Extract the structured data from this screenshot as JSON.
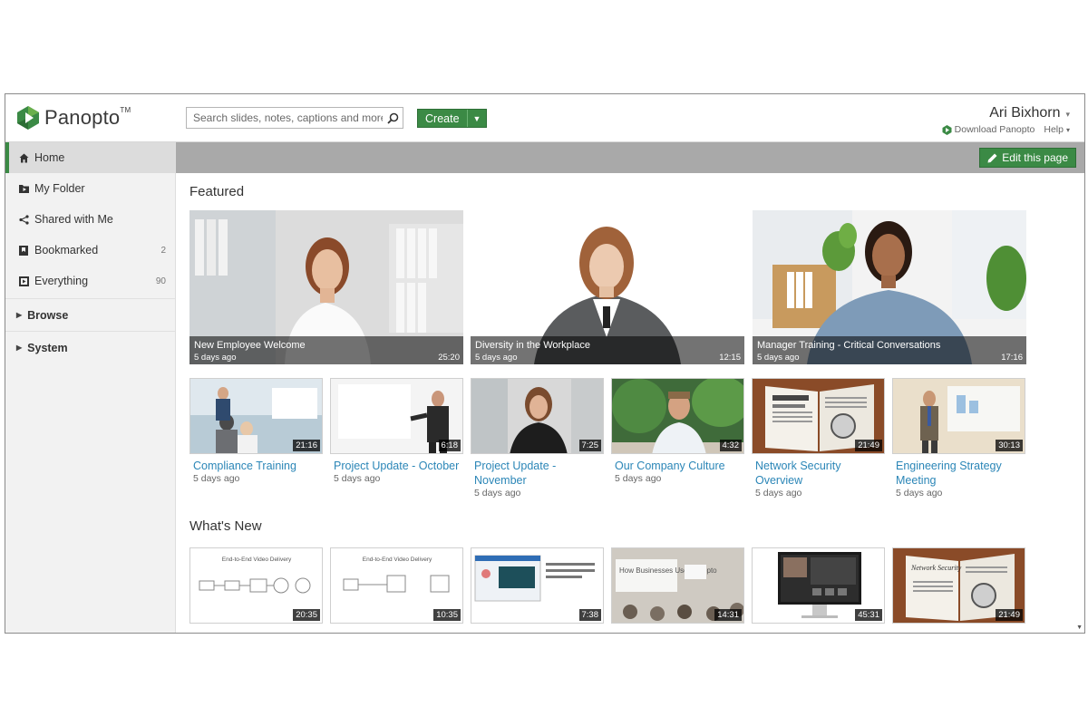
{
  "header": {
    "logo_text": "Panopto",
    "logo_tm": "TM",
    "search_placeholder": "Search slides, notes, captions and more",
    "create_label": "Create",
    "user_name": "Ari Bixhorn",
    "download_label": "Download Panopto",
    "help_label": "Help"
  },
  "sidebar": {
    "items": [
      {
        "label": "Home",
        "count": ""
      },
      {
        "label": "My Folder",
        "count": ""
      },
      {
        "label": "Shared with Me",
        "count": ""
      },
      {
        "label": "Bookmarked",
        "count": "2"
      },
      {
        "label": "Everything",
        "count": "90"
      }
    ],
    "sections": [
      {
        "label": "Browse"
      },
      {
        "label": "System"
      }
    ]
  },
  "toolbar": {
    "edit_label": "Edit this page"
  },
  "featured": {
    "title": "Featured",
    "big": [
      {
        "title": "New Employee Welcome",
        "date": "5 days ago",
        "duration": "25:20"
      },
      {
        "title": "Diversity in the Workplace",
        "date": "5 days ago",
        "duration": "12:15"
      },
      {
        "title": "Manager Training - Critical Conversations",
        "date": "5 days ago",
        "duration": "17:16"
      }
    ],
    "small": [
      {
        "title": "Compliance Training",
        "date": "5 days ago",
        "duration": "21:16"
      },
      {
        "title": "Project Update - October",
        "date": "5 days ago",
        "duration": "6:18"
      },
      {
        "title": "Project Update - November",
        "date": "5 days ago",
        "duration": "7:25"
      },
      {
        "title": "Our Company Culture",
        "date": "5 days ago",
        "duration": "4:32"
      },
      {
        "title": "Network Security Overview",
        "date": "5 days ago",
        "duration": "21:49"
      },
      {
        "title": "Engineering Strategy Meeting",
        "date": "5 days ago",
        "duration": "30:13"
      }
    ]
  },
  "whats_new": {
    "title": "What's New",
    "items": [
      {
        "duration": "20:35",
        "slide_text": "End-to-End Video Delivery"
      },
      {
        "duration": "10:35",
        "slide_text": "End-to-End Video Delivery"
      },
      {
        "duration": "7:38",
        "slide_text": ""
      },
      {
        "duration": "14:31",
        "slide_text": "How Businesses Use Panopto"
      },
      {
        "duration": "45:31",
        "slide_text": ""
      },
      {
        "duration": "21:49",
        "slide_text": "Network Security"
      }
    ]
  },
  "colors": {
    "accent_green": "#3b8a45",
    "link_blue": "#2b86b7",
    "bar_gray": "#a9a9a9"
  }
}
